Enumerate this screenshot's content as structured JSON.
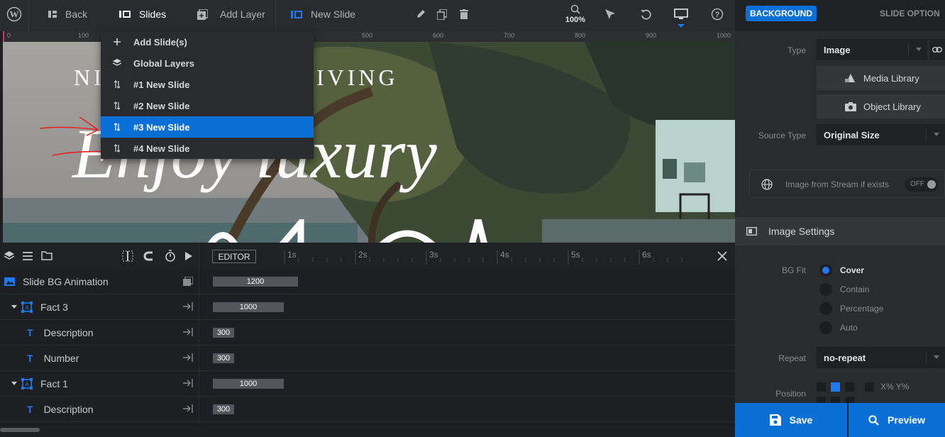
{
  "topbar": {
    "back_label": "Back",
    "slides_label": "Slides",
    "add_layer_label": "Add Layer",
    "slide_name": "New Slide",
    "zoom": "100%"
  },
  "ruler": {
    "ticks": [
      "0",
      "100",
      "500",
      "600",
      "700",
      "800",
      "900",
      "1000"
    ]
  },
  "slides_menu": {
    "items": [
      {
        "label": "Add Slide(s)",
        "icon": "plus-icon"
      },
      {
        "label": "Global Layers",
        "icon": "layers-icon"
      },
      {
        "label": "#1 New Slide",
        "icon": "sort-icon"
      },
      {
        "label": "#2 New Slide",
        "icon": "sort-icon"
      },
      {
        "label": "#3 New Slide",
        "icon": "sort-icon",
        "active": true
      },
      {
        "label": "#4 New Slide",
        "icon": "sort-icon"
      }
    ]
  },
  "canvas": {
    "heading_left": "NI",
    "heading_right": "IVING",
    "big_text": "Enjoy luxury"
  },
  "timeline": {
    "editor_label": "EDITOR",
    "ticks": [
      "1s",
      "2s",
      "3s",
      "4s",
      "5s",
      "6s"
    ],
    "rows": [
      {
        "label": "Slide BG Animation",
        "value": "1200"
      },
      {
        "label": "Fact 3",
        "value": "1000"
      },
      {
        "label": "Description",
        "value": "300"
      },
      {
        "label": "Number",
        "value": "300"
      },
      {
        "label": "Fact 1",
        "value": "1000"
      },
      {
        "label": "Description",
        "value": "300"
      }
    ]
  },
  "right_panel": {
    "tab_background": "BACKGROUND",
    "tab_slide_options": "SLIDE OPTION",
    "type_label": "Type",
    "type_value": "Image",
    "media_library": "Media Library",
    "object_library": "Object Library",
    "source_type_label": "Source Type",
    "source_type_value": "Original Size",
    "stream_label": "Image from Stream if exists",
    "stream_toggle": "OFF",
    "image_settings": "Image Settings",
    "bg_fit_label": "BG Fit",
    "bg_fit_options": [
      "Cover",
      "Contain",
      "Percentage",
      "Auto"
    ],
    "bg_fit_selected": "Cover",
    "repeat_label": "Repeat",
    "repeat_value": "no-repeat",
    "position_label": "Position",
    "position_xy": "X% Y%",
    "save_label": "Save",
    "preview_label": "Preview"
  },
  "colors": {
    "accent": "#0a6fd6",
    "panel": "#2a2b2e",
    "dark": "#1e1f22"
  }
}
